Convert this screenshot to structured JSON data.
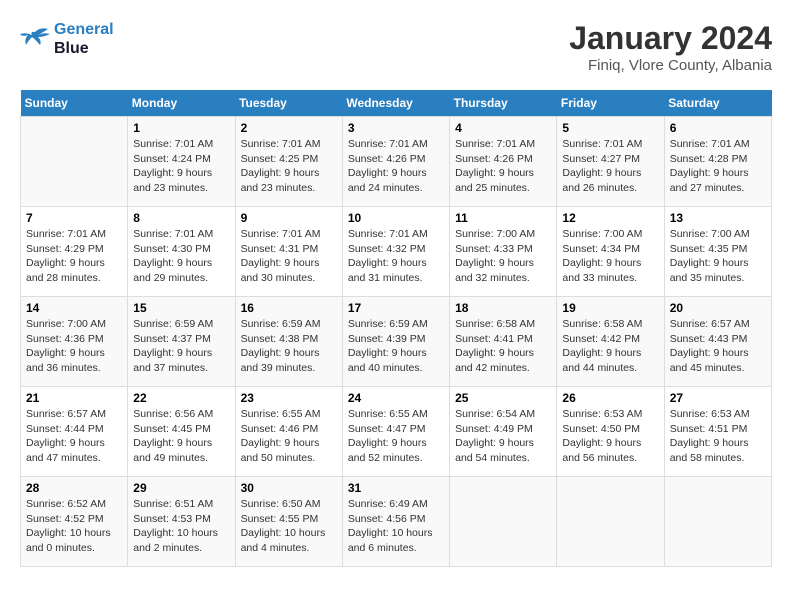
{
  "header": {
    "logo_line1": "General",
    "logo_line2": "Blue",
    "month_title": "January 2024",
    "location": "Finiq, Vlore County, Albania"
  },
  "days_of_week": [
    "Sunday",
    "Monday",
    "Tuesday",
    "Wednesday",
    "Thursday",
    "Friday",
    "Saturday"
  ],
  "weeks": [
    [
      {
        "day": "",
        "info": ""
      },
      {
        "day": "1",
        "info": "Sunrise: 7:01 AM\nSunset: 4:24 PM\nDaylight: 9 hours\nand 23 minutes."
      },
      {
        "day": "2",
        "info": "Sunrise: 7:01 AM\nSunset: 4:25 PM\nDaylight: 9 hours\nand 23 minutes."
      },
      {
        "day": "3",
        "info": "Sunrise: 7:01 AM\nSunset: 4:26 PM\nDaylight: 9 hours\nand 24 minutes."
      },
      {
        "day": "4",
        "info": "Sunrise: 7:01 AM\nSunset: 4:26 PM\nDaylight: 9 hours\nand 25 minutes."
      },
      {
        "day": "5",
        "info": "Sunrise: 7:01 AM\nSunset: 4:27 PM\nDaylight: 9 hours\nand 26 minutes."
      },
      {
        "day": "6",
        "info": "Sunrise: 7:01 AM\nSunset: 4:28 PM\nDaylight: 9 hours\nand 27 minutes."
      }
    ],
    [
      {
        "day": "7",
        "info": ""
      },
      {
        "day": "8",
        "info": "Sunrise: 7:01 AM\nSunset: 4:30 PM\nDaylight: 9 hours\nand 29 minutes."
      },
      {
        "day": "9",
        "info": "Sunrise: 7:01 AM\nSunset: 4:31 PM\nDaylight: 9 hours\nand 30 minutes."
      },
      {
        "day": "10",
        "info": "Sunrise: 7:01 AM\nSunset: 4:32 PM\nDaylight: 9 hours\nand 31 minutes."
      },
      {
        "day": "11",
        "info": "Sunrise: 7:00 AM\nSunset: 4:33 PM\nDaylight: 9 hours\nand 32 minutes."
      },
      {
        "day": "12",
        "info": "Sunrise: 7:00 AM\nSunset: 4:34 PM\nDaylight: 9 hours\nand 33 minutes."
      },
      {
        "day": "13",
        "info": "Sunrise: 7:00 AM\nSunset: 4:35 PM\nDaylight: 9 hours\nand 35 minutes."
      }
    ],
    [
      {
        "day": "14",
        "info": ""
      },
      {
        "day": "15",
        "info": "Sunrise: 6:59 AM\nSunset: 4:37 PM\nDaylight: 9 hours\nand 37 minutes."
      },
      {
        "day": "16",
        "info": "Sunrise: 6:59 AM\nSunset: 4:38 PM\nDaylight: 9 hours\nand 39 minutes."
      },
      {
        "day": "17",
        "info": "Sunrise: 6:59 AM\nSunset: 4:39 PM\nDaylight: 9 hours\nand 40 minutes."
      },
      {
        "day": "18",
        "info": "Sunrise: 6:58 AM\nSunset: 4:41 PM\nDaylight: 9 hours\nand 42 minutes."
      },
      {
        "day": "19",
        "info": "Sunrise: 6:58 AM\nSunset: 4:42 PM\nDaylight: 9 hours\nand 44 minutes."
      },
      {
        "day": "20",
        "info": "Sunrise: 6:57 AM\nSunset: 4:43 PM\nDaylight: 9 hours\nand 45 minutes."
      }
    ],
    [
      {
        "day": "21",
        "info": ""
      },
      {
        "day": "22",
        "info": "Sunrise: 6:56 AM\nSunset: 4:45 PM\nDaylight: 9 hours\nand 49 minutes."
      },
      {
        "day": "23",
        "info": "Sunrise: 6:55 AM\nSunset: 4:46 PM\nDaylight: 9 hours\nand 50 minutes."
      },
      {
        "day": "24",
        "info": "Sunrise: 6:55 AM\nSunset: 4:47 PM\nDaylight: 9 hours\nand 52 minutes."
      },
      {
        "day": "25",
        "info": "Sunrise: 6:54 AM\nSunset: 4:49 PM\nDaylight: 9 hours\nand 54 minutes."
      },
      {
        "day": "26",
        "info": "Sunrise: 6:53 AM\nSunset: 4:50 PM\nDaylight: 9 hours\nand 56 minutes."
      },
      {
        "day": "27",
        "info": "Sunrise: 6:53 AM\nSunset: 4:51 PM\nDaylight: 9 hours\nand 58 minutes."
      }
    ],
    [
      {
        "day": "28",
        "info": ""
      },
      {
        "day": "29",
        "info": "Sunrise: 6:51 AM\nSunset: 4:53 PM\nDaylight: 10 hours\nand 2 minutes."
      },
      {
        "day": "30",
        "info": "Sunrise: 6:50 AM\nSunset: 4:55 PM\nDaylight: 10 hours\nand 4 minutes."
      },
      {
        "day": "31",
        "info": "Sunrise: 6:49 AM\nSunset: 4:56 PM\nDaylight: 10 hours\nand 6 minutes."
      },
      {
        "day": "",
        "info": ""
      },
      {
        "day": "",
        "info": ""
      },
      {
        "day": "",
        "info": ""
      }
    ]
  ],
  "week1_sunday": "Sunrise: 7:01 AM\nSunset: 4:29 PM\nDaylight: 9 hours\nand 28 minutes.",
  "week2_sunday_info": "Sunrise: 7:01 AM\nSunset: 4:29 PM\nDaylight: 9 hours\nand 28 minutes.",
  "week3_sunday_info": "Sunrise: 7:00 AM\nSunset: 4:36 PM\nDaylight: 9 hours\nand 36 minutes.",
  "week4_sunday_info": "Sunrise: 6:57 AM\nSunset: 4:44 PM\nDaylight: 9 hours\nand 47 minutes.",
  "week5_sunday_info": "Sunrise: 6:52 AM\nSunset: 4:52 PM\nDaylight: 10 hours\nand 0 minutes."
}
